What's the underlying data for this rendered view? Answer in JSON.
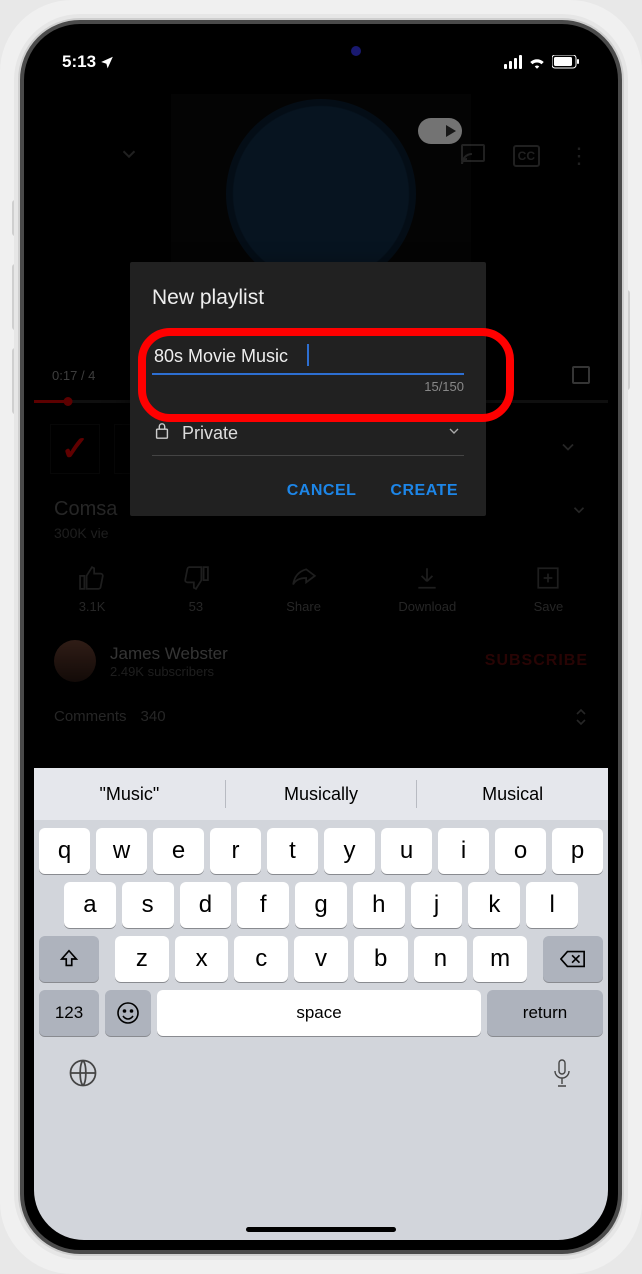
{
  "status": {
    "time": "5:13",
    "location_glyph": "➤"
  },
  "video": {
    "topControls": {
      "cast": "cast-icon",
      "cc": "CC",
      "more": "⋮"
    },
    "progress": {
      "elapsed": "0:17",
      "sep": "/ 4"
    },
    "titlePartial": "Comsa",
    "viewsPartial": "300K vie",
    "actions": {
      "like": "3.1K",
      "dislike": "53",
      "share": "Share",
      "download": "Download",
      "save": "Save"
    },
    "channel": {
      "name": "James Webster",
      "subs": "2.49K subscribers",
      "subscribe": "SUBSCRIBE"
    },
    "comments": {
      "label": "Comments",
      "count": "340"
    }
  },
  "modal": {
    "title": "New playlist",
    "input_value": "80s Movie Music",
    "counter": "15/150",
    "privacy": "Private",
    "cancel": "CANCEL",
    "create": "CREATE"
  },
  "keyboard": {
    "suggestions": [
      "\"Music\"",
      "Musically",
      "Musical"
    ],
    "row1": [
      "q",
      "w",
      "e",
      "r",
      "t",
      "y",
      "u",
      "i",
      "o",
      "p"
    ],
    "row2": [
      "a",
      "s",
      "d",
      "f",
      "g",
      "h",
      "j",
      "k",
      "l"
    ],
    "row3": [
      "z",
      "x",
      "c",
      "v",
      "b",
      "n",
      "m"
    ],
    "nums": "123",
    "space": "space",
    "ret": "return"
  }
}
